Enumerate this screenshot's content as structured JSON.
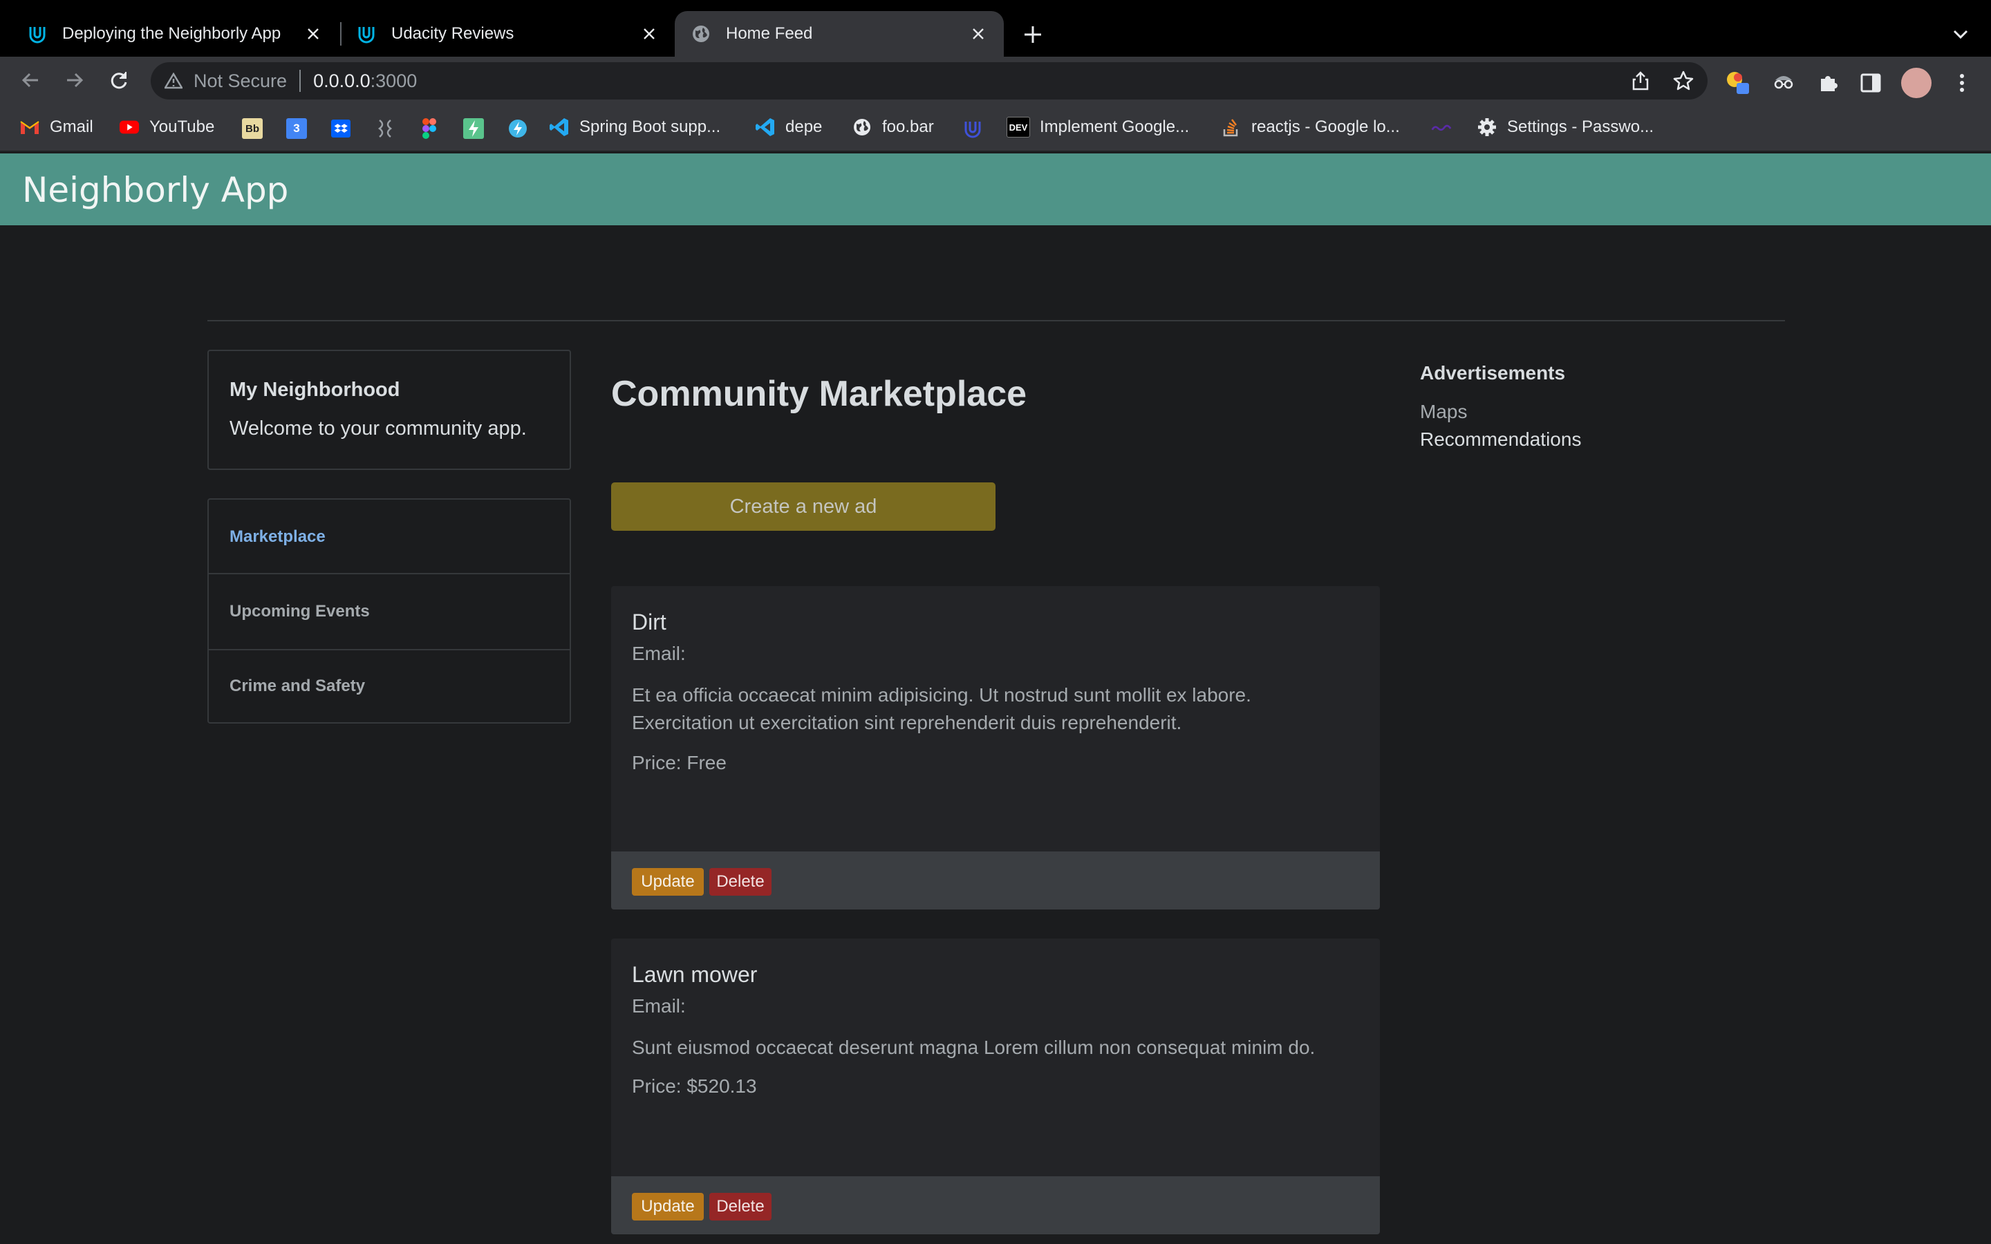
{
  "browser": {
    "tabs": [
      {
        "title": "Deploying the Neighborly App",
        "icon": "udacity-icon",
        "active": false
      },
      {
        "title": "Udacity Reviews",
        "icon": "udacity-icon",
        "active": false
      },
      {
        "title": "Home Feed",
        "icon": "globe-icon",
        "active": true
      }
    ],
    "security_label": "Not Secure",
    "url_host": "0.0.0.0",
    "url_port": ":3000",
    "bookmarks": [
      {
        "label": "Gmail",
        "icon": "gmail-icon"
      },
      {
        "label": "YouTube",
        "icon": "youtube-icon"
      },
      {
        "label": "Spring Boot supp...",
        "icon": "vscode-icon"
      },
      {
        "label": "depe",
        "icon": "vscode-icon"
      },
      {
        "label": "foo.bar",
        "icon": "globe-icon"
      },
      {
        "label": "Implement Google...",
        "icon": "dev-icon"
      },
      {
        "label": "reactjs - Google lo...",
        "icon": "stackoverflow-icon"
      },
      {
        "label": "Settings - Passwo...",
        "icon": "gear-icon"
      }
    ],
    "bookmark_icon_texts": {
      "bb": "Bb",
      "cal": "3",
      "dev": "DEV"
    }
  },
  "app": {
    "title": "Neighborly App",
    "neighborhood": {
      "title": "My Neighborhood",
      "text": "Welcome to your community app."
    },
    "nav": [
      "Marketplace",
      "Upcoming Events",
      "Crime and Safety"
    ],
    "page_heading": "Community Marketplace",
    "create_button": "Create a new ad",
    "ads": [
      {
        "title": "Dirt",
        "email": "Email:",
        "description": "Et ea officia occaecat minim adipisicing. Ut nostrud sunt mollit ex labore. Exercitation ut exercitation sint reprehenderit duis reprehenderit.",
        "price": "Price: Free",
        "update_label": "Update",
        "delete_label": "Delete"
      },
      {
        "title": "Lawn mower",
        "email": "Email:",
        "description": "Sunt eiusmod occaecat deserunt magna Lorem cillum non consequat minim do.",
        "price": "Price: $520.13",
        "update_label": "Update",
        "delete_label": "Delete"
      }
    ],
    "sidebar_right": {
      "title": "Advertisements",
      "links": [
        "Maps",
        "Recommendations"
      ]
    }
  },
  "colors": {
    "header": "#4f9488",
    "create_button": "#7a6b1f",
    "update_button": "#b7771a",
    "delete_button": "#952626",
    "active_nav": "#7eb0e6"
  }
}
